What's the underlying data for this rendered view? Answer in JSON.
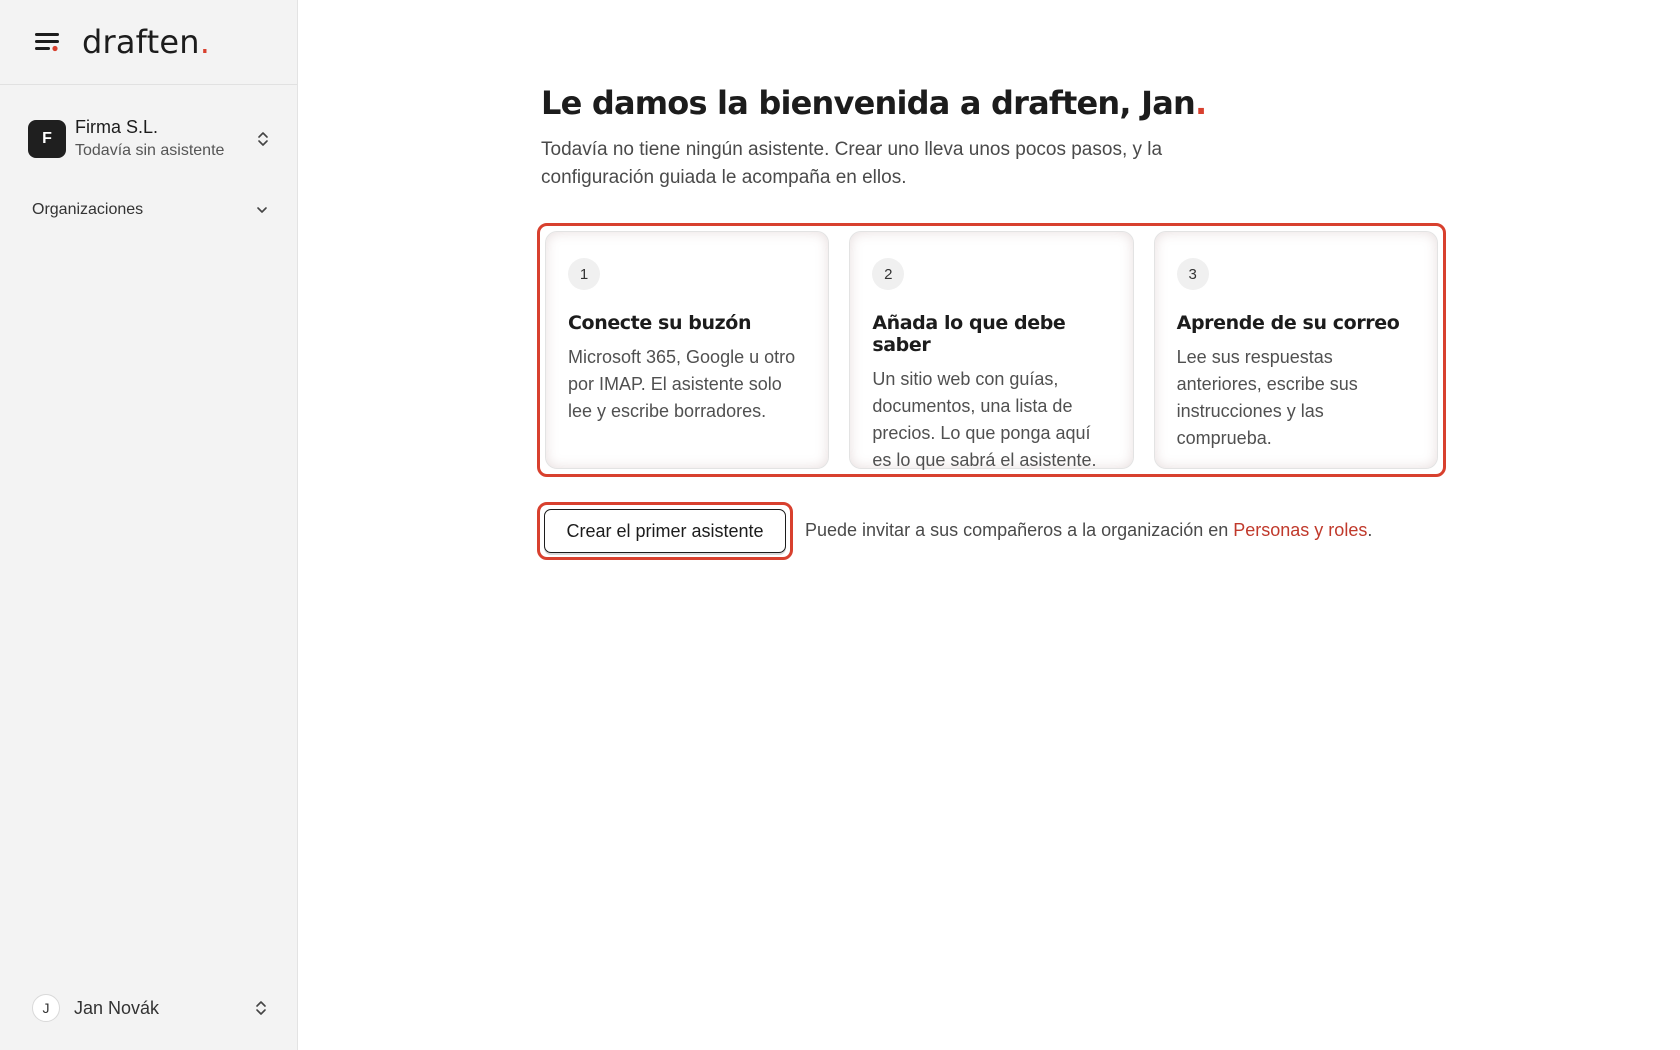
{
  "app": {
    "logo_text": "draften",
    "logo_dot": "."
  },
  "sidebar": {
    "org": {
      "avatar_letter": "F",
      "name": "Firma S.L.",
      "status": "Todavía sin asistente"
    },
    "organizations_label": "Organizaciones",
    "user": {
      "avatar_letter": "J",
      "name": "Jan Novák"
    }
  },
  "main": {
    "title": "Le damos la bienvenida a draften, Jan",
    "title_dot": ".",
    "intro": "Todavía no tiene ningún asistente. Crear uno lleva unos pocos pasos, y la configuración guiada le acompaña en ellos.",
    "steps": [
      {
        "number": "1",
        "title": "Conecte su buzón",
        "description": "Microsoft 365, Google u otro por IMAP. El asistente solo lee y escribe borradores."
      },
      {
        "number": "2",
        "title": "Añada lo que debe saber",
        "description": "Un sitio web con guías, documentos, una lista de precios. Lo que ponga aquí es lo que sabrá el asistente."
      },
      {
        "number": "3",
        "title": "Aprende de su correo",
        "description": "Lee sus respuestas anteriores, escribe sus instrucciones y las comprueba."
      }
    ],
    "cta_label": "Crear el primer asistente",
    "invite_prefix": "Puede invitar a sus compañeros a la organización en ",
    "invite_link": "Personas y roles",
    "invite_suffix": "."
  },
  "colors": {
    "accent": "#d8402e",
    "link": "#c0392b",
    "sidebar_bg": "#f3f3f3"
  },
  "icons": {
    "menu": "menu-icon",
    "org_switch": "chevron-up-down-icon",
    "orgs_expand": "chevron-down-icon",
    "user_switch": "chevron-up-down-icon"
  }
}
